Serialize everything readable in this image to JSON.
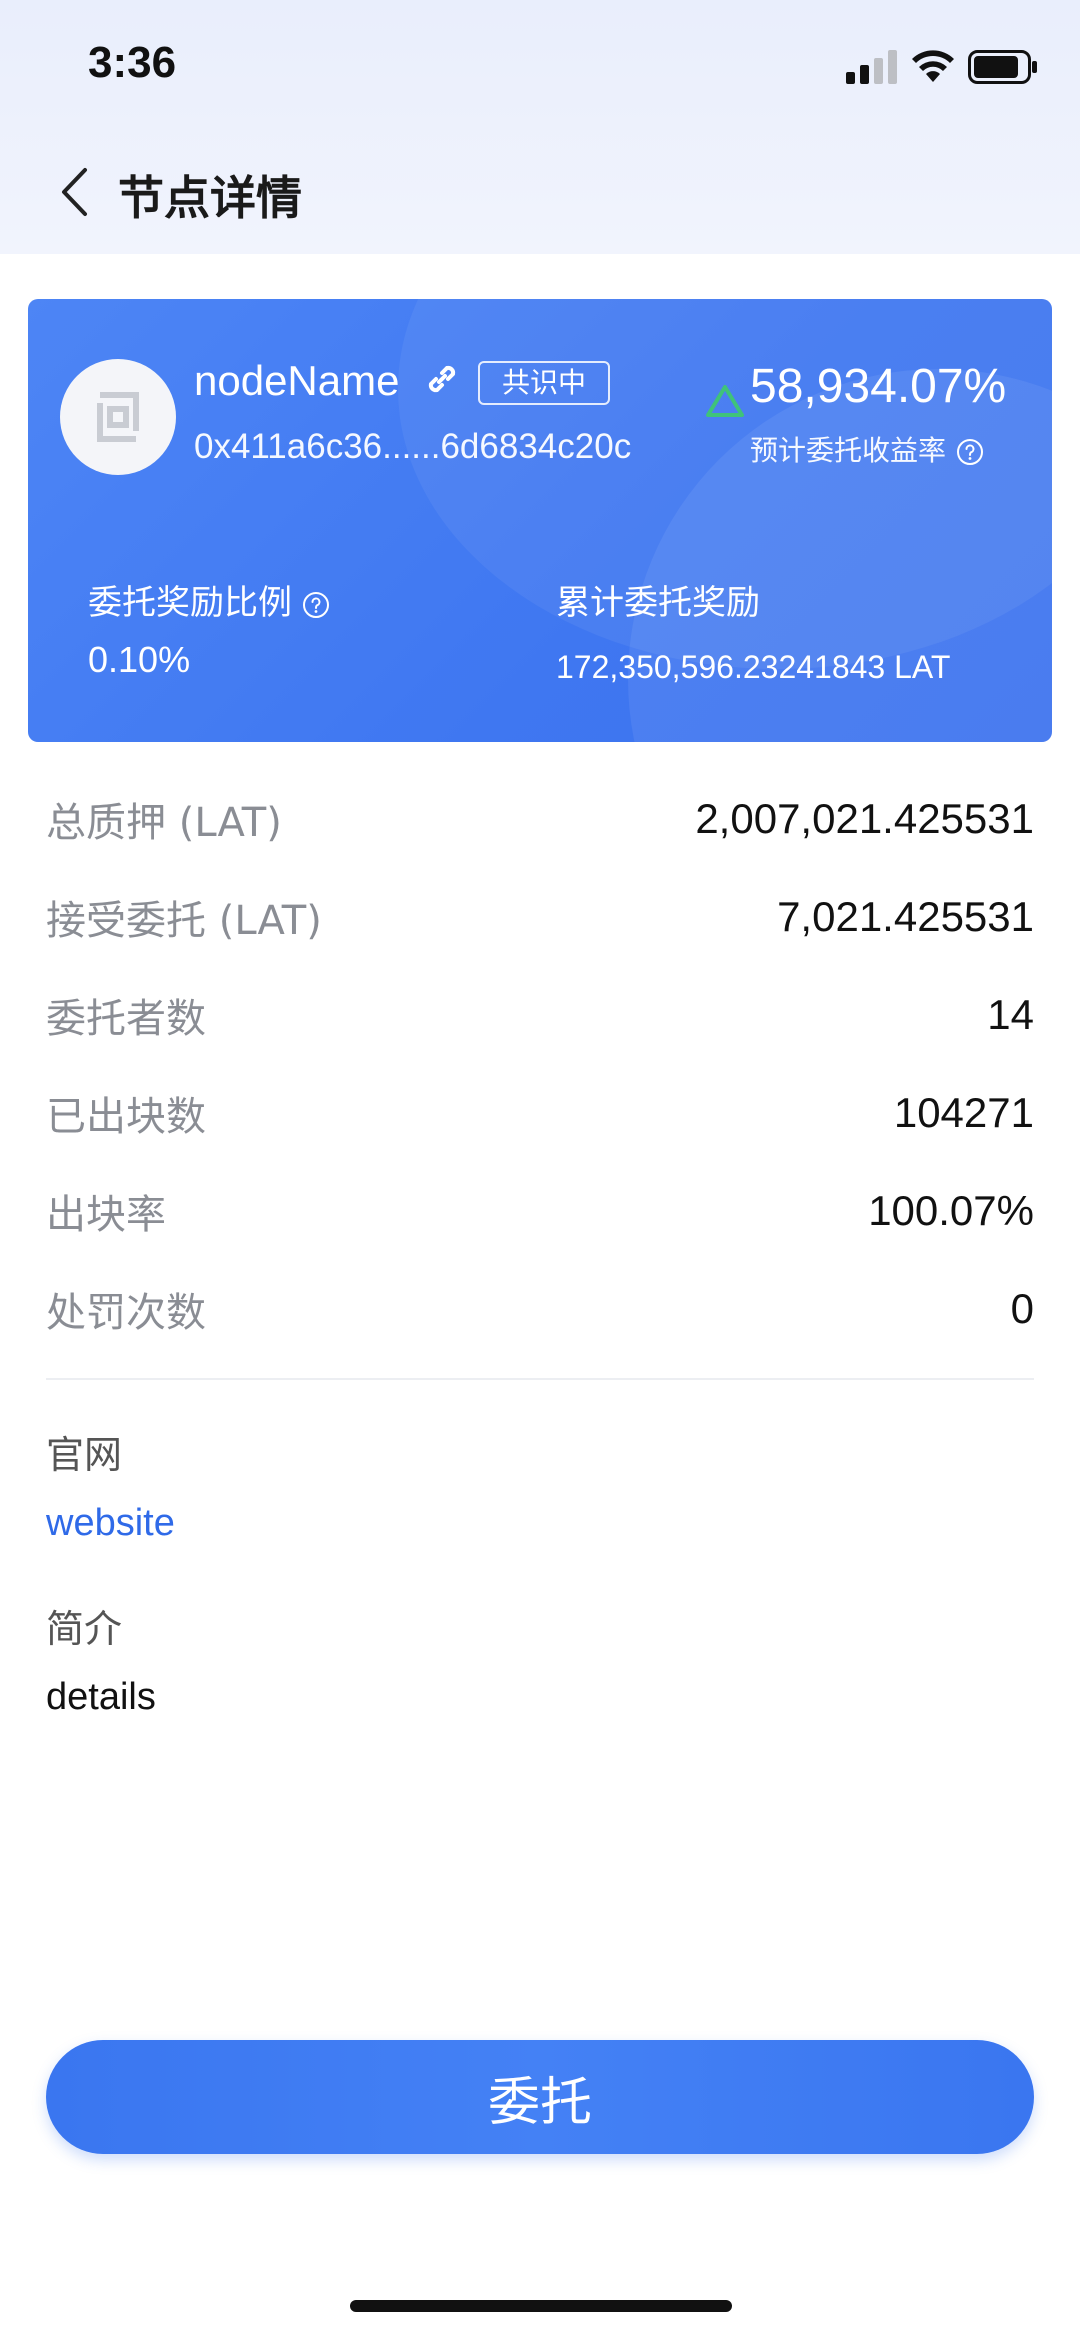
{
  "status_bar": {
    "time": "3:36"
  },
  "nav": {
    "title": "节点详情"
  },
  "card": {
    "node_name": "nodeName",
    "status_badge": "共识中",
    "address": "0x411a6c36......6d6834c20c",
    "yield_value": "58,934.07%",
    "yield_label": "预计委托收益率",
    "ratio_label": "委托奖励比例",
    "ratio_value": "0.10%",
    "reward_label": "累计委托奖励",
    "reward_value": "172,350,596.23241843 LAT",
    "colors": {
      "card": "#4280f2",
      "up_arrow": "#3fc37a"
    }
  },
  "stats": [
    {
      "label": "总质押 (LAT)",
      "value": "2,007,021.425531"
    },
    {
      "label": "接受委托 (LAT)",
      "value": "7,021.425531"
    },
    {
      "label": "委托者数",
      "value": "14"
    },
    {
      "label": "已出块数",
      "value": "104271"
    },
    {
      "label": "出块率",
      "value": "100.07%"
    },
    {
      "label": "处罚次数",
      "value": "0"
    }
  ],
  "info": {
    "website_label": "官网",
    "website_value": "website",
    "intro_label": "简介",
    "intro_value": "details"
  },
  "actions": {
    "delegate_label": "委托"
  }
}
